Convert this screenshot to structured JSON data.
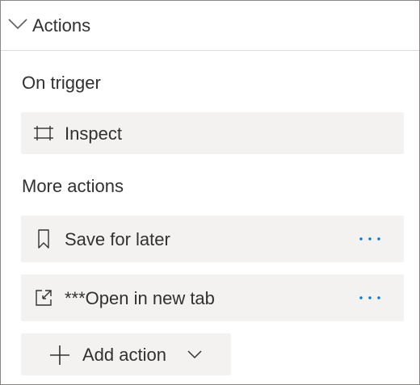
{
  "section": {
    "title": "Actions",
    "icon": "chevron-down-icon"
  },
  "on_trigger": {
    "label": "On trigger",
    "items": [
      {
        "label": "Inspect",
        "icon": "inspect-icon"
      }
    ]
  },
  "more_actions": {
    "label": "More actions",
    "items": [
      {
        "label": "Save for later",
        "icon": "bookmark-icon",
        "more": "more-options-icon"
      },
      {
        "label": "***Open in new tab",
        "icon": "open-in-new-tab-icon",
        "more": "more-options-icon"
      }
    ]
  },
  "add_action": {
    "label": "Add action",
    "icon": "plus-icon",
    "caret": "chevron-down-icon"
  },
  "colors": {
    "accent": "#0078d4",
    "row_background": "#f3f2f1",
    "text": "#323130",
    "border": "#8a8886"
  }
}
